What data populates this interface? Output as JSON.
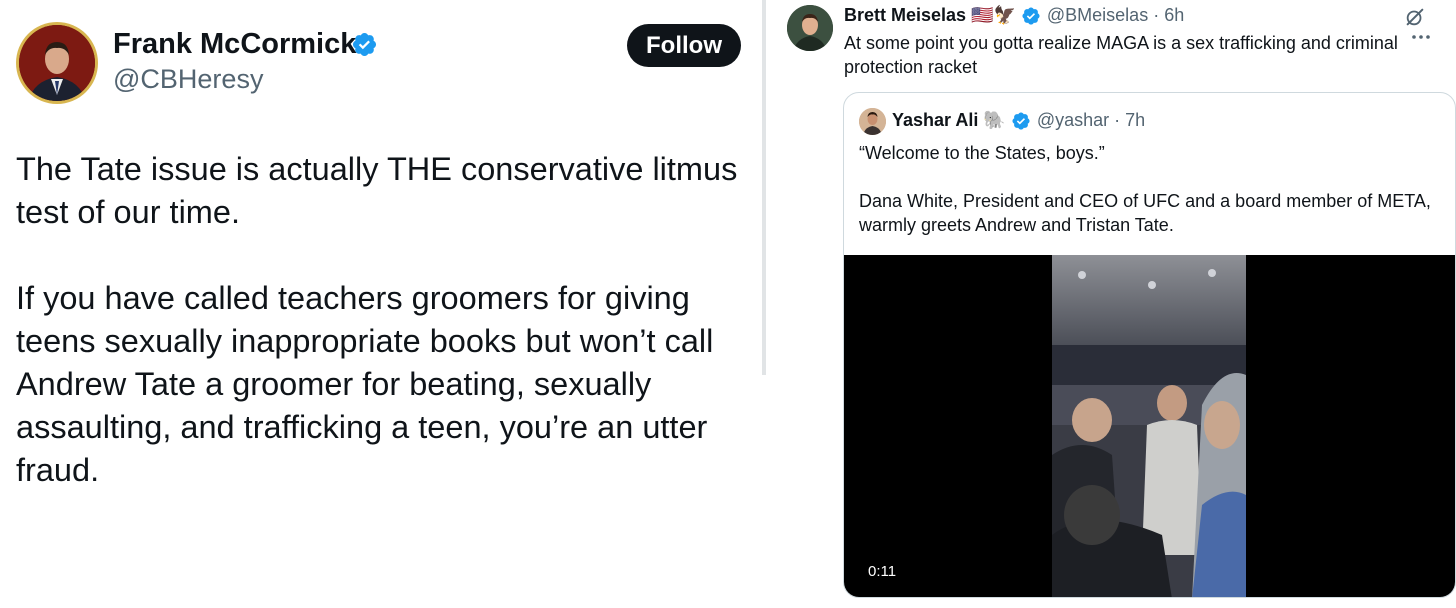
{
  "left_tweet": {
    "author_name": "Frank McCormick",
    "author_handle": "@CBHeresy",
    "follow_label": "Follow",
    "paragraph_1": "The Tate issue is actually THE conservative litmus test of our time.",
    "paragraph_2": "If you have called teachers groomers for giving teens sexually inappropriate books but won’t call Andrew Tate a groomer for beating, sexually assaulting, and trafficking a teen, you’re an utter fraud."
  },
  "right_tweet": {
    "author_name": "Brett Meiselas",
    "author_emojis": "🇺🇸🦅",
    "author_handle_time": "@BMeiselas · 6h",
    "text": "At some point you gotta realize MAGA is a sex trafficking and criminal protection racket",
    "quoted_tweet": {
      "author_name": "Yashar Ali",
      "author_emoji": "🐘",
      "author_handle_time": "@yashar · 7h",
      "line_1": "“Welcome to the States, boys.”",
      "line_2": "Dana White, President and CEO of UFC and a board member of META, warmly greets Andrew and Tristan Tate.",
      "video_duration": "0:11"
    }
  },
  "colors": {
    "verified_blue": "#1d9bf0",
    "text_primary": "#0f1419",
    "text_secondary": "#536471",
    "follow_button_bg": "#0f1419"
  },
  "icons": [
    "verified-badge-icon",
    "grok-icon",
    "more-options-icon"
  ]
}
